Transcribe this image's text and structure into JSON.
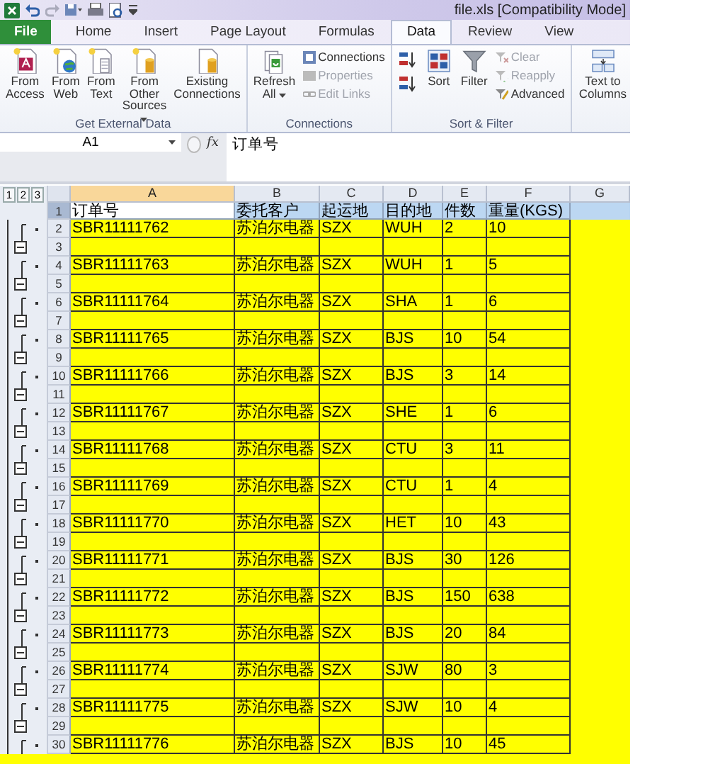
{
  "window": {
    "title": "file.xls  [Compatibility Mode]"
  },
  "tabs": [
    {
      "label": "File",
      "kind": "file",
      "selected": false
    },
    {
      "label": "Home",
      "kind": "tab",
      "selected": false
    },
    {
      "label": "Insert",
      "kind": "tab",
      "selected": false
    },
    {
      "label": "Page Layout",
      "kind": "tab",
      "selected": false
    },
    {
      "label": "Formulas",
      "kind": "tab",
      "selected": false
    },
    {
      "label": "Data",
      "kind": "tab",
      "selected": true
    },
    {
      "label": "Review",
      "kind": "tab",
      "selected": false
    },
    {
      "label": "View",
      "kind": "tab",
      "selected": false
    }
  ],
  "ribbon": {
    "groups": [
      {
        "label": "Get External Data",
        "items": [
          {
            "kind": "large",
            "label": "From Access",
            "dropdown": false
          },
          {
            "kind": "large",
            "label": "From Web",
            "dropdown": false
          },
          {
            "kind": "large",
            "label": "From Text",
            "dropdown": false
          },
          {
            "kind": "large",
            "label": "From Other Sources",
            "dropdown": true
          },
          {
            "kind": "large",
            "label": "Existing Connections",
            "dropdown": false
          }
        ]
      },
      {
        "label": "Connections",
        "items": [
          {
            "kind": "large",
            "label": "Refresh All",
            "dropdown": true
          },
          {
            "kind": "small",
            "label": "Connections",
            "disabled": false
          },
          {
            "kind": "small",
            "label": "Properties",
            "disabled": true
          },
          {
            "kind": "small",
            "label": "Edit Links",
            "disabled": true
          }
        ]
      },
      {
        "label": "Sort & Filter",
        "items": [
          {
            "kind": "icon"
          },
          {
            "kind": "icon"
          },
          {
            "kind": "large",
            "label": "Sort",
            "dropdown": false
          },
          {
            "kind": "large",
            "label": "Filter",
            "dropdown": false
          },
          {
            "kind": "small",
            "label": "Clear",
            "disabled": true
          },
          {
            "kind": "small",
            "label": "Reapply",
            "disabled": true
          },
          {
            "kind": "small",
            "label": "Advanced",
            "disabled": false
          }
        ]
      },
      {
        "items": [
          {
            "kind": "large",
            "label": "Text to Columns",
            "dropdown": false
          }
        ]
      }
    ]
  },
  "formula_bar": {
    "name_box": "A1",
    "function_label": "fx",
    "content": "订单号"
  },
  "sheet": {
    "outline_levels": [
      "1",
      "2",
      "3"
    ],
    "columns": [
      {
        "label": "A",
        "selected": true
      },
      {
        "label": "B",
        "selected": false
      },
      {
        "label": "C",
        "selected": false
      },
      {
        "label": "D",
        "selected": false
      },
      {
        "label": "E",
        "selected": false
      },
      {
        "label": "F",
        "selected": false
      },
      {
        "label": "G",
        "selected": false
      }
    ],
    "rows": [
      {
        "number": "1",
        "kind": "header",
        "selected": true,
        "cells": [
          "订单号",
          "委托客户",
          "起运地",
          "目的地",
          "件数",
          "重量(KGS)"
        ]
      },
      {
        "number": "2",
        "kind": "data",
        "selected": false,
        "cells": [
          "SBR11111762",
          "苏泊尔电器",
          "SZX",
          "WUH",
          "2",
          "10"
        ]
      },
      {
        "number": "3",
        "kind": "blank",
        "selected": false
      },
      {
        "number": "4",
        "kind": "data",
        "selected": false,
        "cells": [
          "SBR11111763",
          "苏泊尔电器",
          "SZX",
          "WUH",
          "1",
          "5"
        ]
      },
      {
        "number": "5",
        "kind": "blank",
        "selected": false
      },
      {
        "number": "6",
        "kind": "data",
        "selected": false,
        "cells": [
          "SBR11111764",
          "苏泊尔电器",
          "SZX",
          "SHA",
          "1",
          "6"
        ]
      },
      {
        "number": "7",
        "kind": "blank",
        "selected": false
      },
      {
        "number": "8",
        "kind": "data",
        "selected": false,
        "cells": [
          "SBR11111765",
          "苏泊尔电器",
          "SZX",
          "BJS",
          "10",
          "54"
        ]
      },
      {
        "number": "9",
        "kind": "blank",
        "selected": false
      },
      {
        "number": "10",
        "kind": "data",
        "selected": false,
        "cells": [
          "SBR11111766",
          "苏泊尔电器",
          "SZX",
          "BJS",
          "3",
          "14"
        ]
      },
      {
        "number": "11",
        "kind": "blank",
        "selected": false
      },
      {
        "number": "12",
        "kind": "data",
        "selected": false,
        "cells": [
          "SBR11111767",
          "苏泊尔电器",
          "SZX",
          "SHE",
          "1",
          "6"
        ]
      },
      {
        "number": "13",
        "kind": "blank",
        "selected": false
      },
      {
        "number": "14",
        "kind": "data",
        "selected": false,
        "cells": [
          "SBR11111768",
          "苏泊尔电器",
          "SZX",
          "CTU",
          "3",
          "11"
        ]
      },
      {
        "number": "15",
        "kind": "blank",
        "selected": false
      },
      {
        "number": "16",
        "kind": "data",
        "selected": false,
        "cells": [
          "SBR11111769",
          "苏泊尔电器",
          "SZX",
          "CTU",
          "1",
          "4"
        ]
      },
      {
        "number": "17",
        "kind": "blank",
        "selected": false
      },
      {
        "number": "18",
        "kind": "data",
        "selected": false,
        "cells": [
          "SBR11111770",
          "苏泊尔电器",
          "SZX",
          "HET",
          "10",
          "43"
        ]
      },
      {
        "number": "19",
        "kind": "blank",
        "selected": false
      },
      {
        "number": "20",
        "kind": "data",
        "selected": false,
        "cells": [
          "SBR11111771",
          "苏泊尔电器",
          "SZX",
          "BJS",
          "30",
          "126"
        ]
      },
      {
        "number": "21",
        "kind": "blank",
        "selected": false
      },
      {
        "number": "22",
        "kind": "data",
        "selected": false,
        "cells": [
          "SBR11111772",
          "苏泊尔电器",
          "SZX",
          "BJS",
          "150",
          "638"
        ]
      },
      {
        "number": "23",
        "kind": "blank",
        "selected": false
      },
      {
        "number": "24",
        "kind": "data",
        "selected": false,
        "cells": [
          "SBR11111773",
          "苏泊尔电器",
          "SZX",
          "BJS",
          "20",
          "84"
        ]
      },
      {
        "number": "25",
        "kind": "blank",
        "selected": false
      },
      {
        "number": "26",
        "kind": "data",
        "selected": false,
        "cells": [
          "SBR11111774",
          "苏泊尔电器",
          "SZX",
          "SJW",
          "80",
          "3"
        ]
      },
      {
        "number": "27",
        "kind": "blank",
        "selected": false
      },
      {
        "number": "28",
        "kind": "data",
        "selected": false,
        "cells": [
          "SBR11111775",
          "苏泊尔电器",
          "SZX",
          "SJW",
          "10",
          "4"
        ]
      },
      {
        "number": "29",
        "kind": "blank",
        "selected": false
      },
      {
        "number": "30",
        "kind": "data",
        "selected": false,
        "cells": [
          "SBR11111776",
          "苏泊尔电器",
          "SZX",
          "BJS",
          "10",
          "45"
        ]
      }
    ]
  }
}
